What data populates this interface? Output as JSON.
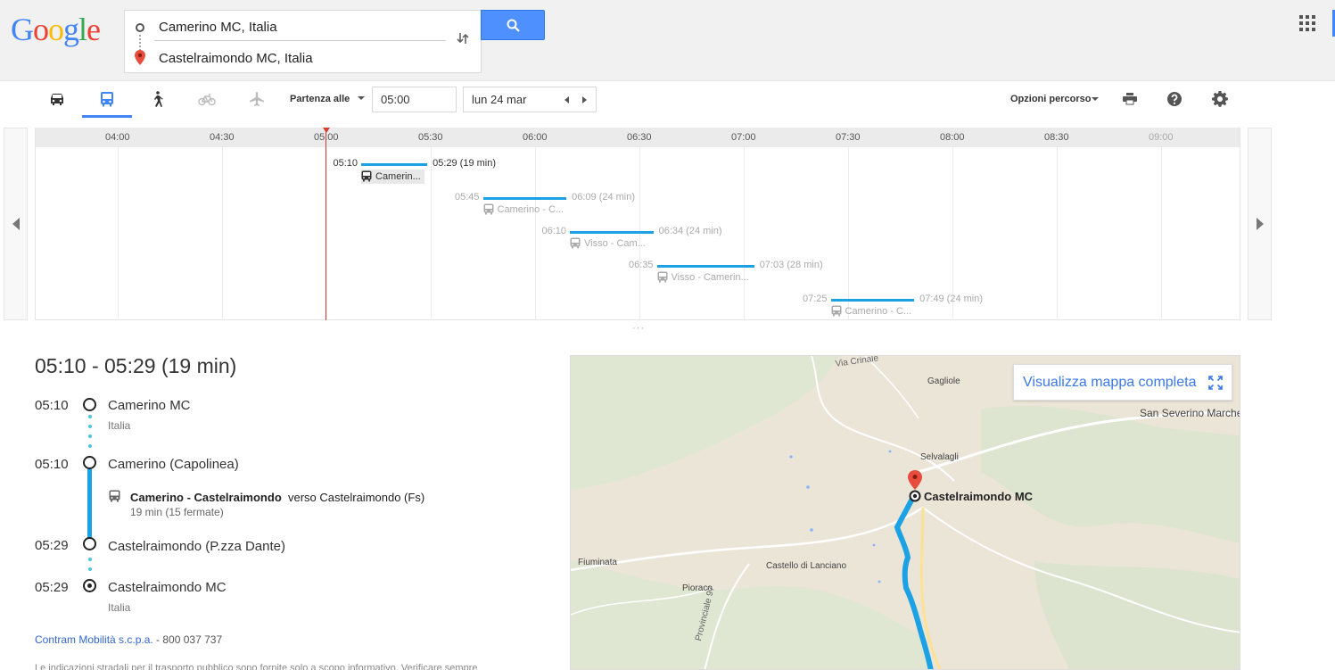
{
  "header": {
    "logo_letters": [
      {
        "ch": "G",
        "color": "#4285f4"
      },
      {
        "ch": "o",
        "color": "#ea4335"
      },
      {
        "ch": "o",
        "color": "#fbbc05"
      },
      {
        "ch": "g",
        "color": "#4285f4"
      },
      {
        "ch": "l",
        "color": "#34a853"
      },
      {
        "ch": "e",
        "color": "#ea4335"
      }
    ],
    "origin": "Camerino MC, Italia",
    "destination": "Castelraimondo MC, Italia",
    "swap_icon": "swap-vertical-icon",
    "search_icon": "search-icon",
    "apps_icon": "apps-grid-icon"
  },
  "toolbar": {
    "modes": [
      {
        "name": "car",
        "icon": "car-icon",
        "active": false
      },
      {
        "name": "transit",
        "icon": "bus-icon",
        "active": true
      },
      {
        "name": "walk",
        "icon": "walk-icon",
        "active": false
      },
      {
        "name": "bike",
        "icon": "bike-icon",
        "active": false,
        "disabled": true
      },
      {
        "name": "flight",
        "icon": "plane-icon",
        "active": false,
        "disabled": true
      }
    ],
    "depart_label": "Partenza alle",
    "time_value": "05:00",
    "date_value": "lun 24 mar",
    "route_options": "Opzioni percorso",
    "print_icon": "print-icon",
    "help_icon": "help-icon",
    "settings_icon": "gear-icon"
  },
  "timeline": {
    "hours": [
      "04:00",
      "04:30",
      "05:00",
      "05:30",
      "06:00",
      "06:30",
      "07:00",
      "07:30",
      "08:00",
      "08:30",
      "09:00"
    ],
    "trips": [
      {
        "dep": "05:10",
        "arr": "05:29 (19 min)",
        "line": "Camerin...",
        "selected": true
      },
      {
        "dep": "05:45",
        "arr": "06:09 (24 min)",
        "line": "Camerino - C...",
        "selected": false
      },
      {
        "dep": "06:10",
        "arr": "06:34 (24 min)",
        "line": "Visso - Cam...",
        "selected": false
      },
      {
        "dep": "06:35",
        "arr": "07:03 (28 min)",
        "line": "Visso - Camerin...",
        "selected": false
      },
      {
        "dep": "07:25",
        "arr": "07:49 (24 min)",
        "line": "Camerino - C...",
        "selected": false
      }
    ],
    "resize_handle": "···"
  },
  "detail": {
    "title": "05:10 - 05:29 (19 min)",
    "stops": [
      {
        "time": "05:10",
        "name": "Camerino MC",
        "sub": "Italia"
      },
      {
        "time": "05:10",
        "name": "Camerino (Capolinea)",
        "sub": ""
      },
      {
        "time": "05:29",
        "name": "Castelraimondo (P.zza Dante)",
        "sub": ""
      },
      {
        "time": "05:29",
        "name": "Castelraimondo MC",
        "sub": "Italia"
      }
    ],
    "line_name": "Camerino - Castelraimondo",
    "line_direction": "verso Castelraimondo (Fs)",
    "line_duration": "19 min (15 fermate)",
    "agency_name": "Contram Mobilità s.c.p.a.",
    "agency_phone": " - 800 037 737",
    "footer_text": "Le indicazioni stradali per il trasporto pubblico sono fornite solo a scopo informativo. Verificare sempre orari e fermate."
  },
  "map": {
    "full_map_label": "Visualizza mappa completa",
    "labels": [
      {
        "text": "Via Crinale",
        "cls": "road"
      },
      {
        "text": "Gagliole",
        "cls": "town"
      },
      {
        "text": "San Severino Marche",
        "cls": "town-lg"
      },
      {
        "text": "Selvalagli",
        "cls": "town"
      },
      {
        "text": "Fiuminata",
        "cls": "town"
      },
      {
        "text": "Castello di Lanciano",
        "cls": "town"
      },
      {
        "text": "Pioraco",
        "cls": "town"
      },
      {
        "text": "Provinciale 97",
        "cls": "road"
      }
    ],
    "destination_label": "Castelraimondo MC"
  }
}
